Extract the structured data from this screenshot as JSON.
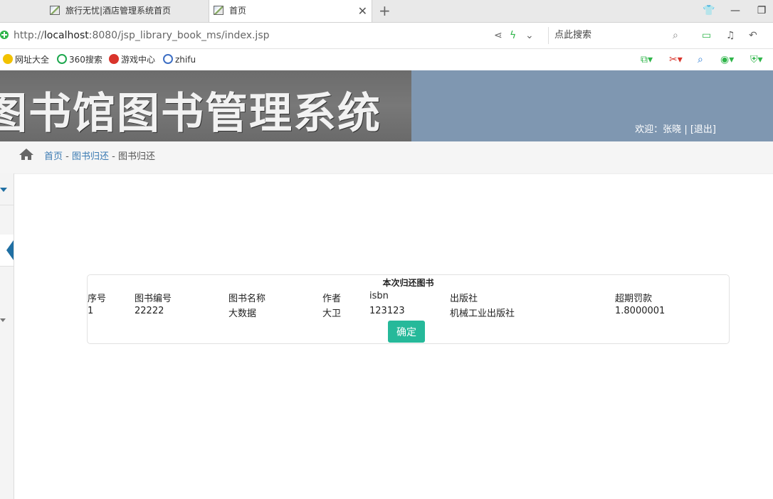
{
  "browser": {
    "tabs": [
      {
        "title": "旅行无忧|酒店管理系统首页"
      },
      {
        "title": "首页"
      }
    ],
    "new_tab": "+",
    "address": {
      "prefix": "http://",
      "host": "localhost",
      "rest": ":8080/jsp_library_book_ms/index.jsp"
    },
    "search_placeholder": "点此搜索",
    "bookmarks": [
      {
        "label": "网址大全",
        "color": "#f2c200"
      },
      {
        "label": "360搜索",
        "color": "#1fa84f"
      },
      {
        "label": "游戏中心",
        "color": "#d9342b"
      },
      {
        "label": "zhifu",
        "color": "#3e6fc4"
      }
    ]
  },
  "header": {
    "banner_title": "图书馆图书管理系统",
    "welcome_prefix": "欢迎：",
    "username": "张晓",
    "separator": " | ",
    "logout": "[退出]"
  },
  "breadcrumb": {
    "home": "首页",
    "sep1": " - ",
    "parent": "图书归还",
    "sep2": " - ",
    "current": "图书归还"
  },
  "return_box": {
    "title": "本次归还图书",
    "columns": [
      "序号",
      "图书编号",
      "图书名称",
      "作者",
      "isbn",
      "出版社",
      "超期罚款"
    ],
    "rows": [
      [
        "1",
        "22222",
        "大数据",
        "大卫",
        "123123",
        "机械工业出版社",
        "1.8000001"
      ]
    ],
    "confirm_label": "确定"
  },
  "colors": {
    "banner_bg": "#7f97b1",
    "confirm_bg": "#26b99a",
    "link": "#3a7ab3"
  }
}
